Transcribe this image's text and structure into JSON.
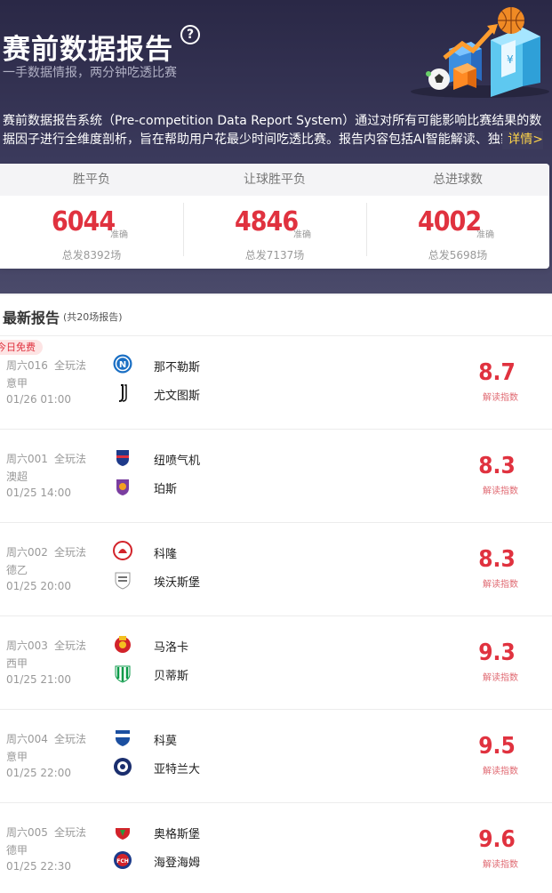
{
  "header": {
    "title": "赛前数据报告",
    "help_icon": "question-circle-icon",
    "subtitle": "一手数据情报，两分钟吃透比赛",
    "description": "赛前数据报告系统（Pre-competition Data Report System）通过对所有可能影响比赛结果的数据因子进行全维度剖析，旨在帮助用户花最少时间吃透比赛。报告内容包括AI智能解读、独家临场",
    "more_label": "详情>"
  },
  "stats": [
    {
      "title": "胜平负",
      "number": "6044",
      "accuracy_label": "准确",
      "total": "总发8392场"
    },
    {
      "title": "让球胜平负",
      "number": "4846",
      "accuracy_label": "准确",
      "total": "总发7137场"
    },
    {
      "title": "总进球数",
      "number": "4002",
      "accuracy_label": "准确",
      "total": "总发5698场"
    }
  ],
  "reports": {
    "title": "最新报告",
    "count": "(共20场报告)",
    "free_tag": "今日免费",
    "score_label": "解读指数",
    "items": [
      {
        "week": "周六016",
        "play": "全玩法",
        "league": "意甲",
        "time": "01/26 01:00",
        "home": "那不勒斯",
        "away": "尤文图斯",
        "home_logo": "napoli-logo-icon",
        "away_logo": "juventus-logo-icon",
        "score": "8.7"
      },
      {
        "week": "周六001",
        "play": "全玩法",
        "league": "澳超",
        "time": "01/25 14:00",
        "home": "纽喷气机",
        "away": "珀斯",
        "home_logo": "newcastle-jets-logo-icon",
        "away_logo": "perth-glory-logo-icon",
        "score": "8.3"
      },
      {
        "week": "周六002",
        "play": "全玩法",
        "league": "德乙",
        "time": "01/25 20:00",
        "home": "科隆",
        "away": "埃沃斯堡",
        "home_logo": "koln-logo-icon",
        "away_logo": "elversberg-logo-icon",
        "score": "8.3"
      },
      {
        "week": "周六003",
        "play": "全玩法",
        "league": "西甲",
        "time": "01/25 21:00",
        "home": "马洛卡",
        "away": "贝蒂斯",
        "home_logo": "mallorca-logo-icon",
        "away_logo": "betis-logo-icon",
        "score": "9.3"
      },
      {
        "week": "周六004",
        "play": "全玩法",
        "league": "意甲",
        "time": "01/25 22:00",
        "home": "科莫",
        "away": "亚特兰大",
        "home_logo": "como-logo-icon",
        "away_logo": "atalanta-logo-icon",
        "score": "9.5"
      },
      {
        "week": "周六005",
        "play": "全玩法",
        "league": "德甲",
        "time": "01/25 22:30",
        "home": "奥格斯堡",
        "away": "海登海姆",
        "home_logo": "augsburg-logo-icon",
        "away_logo": "heidenheim-logo-icon",
        "score": "9.6"
      }
    ]
  },
  "colors": {
    "accent": "#e0323f",
    "header_bg": "#2a2846",
    "link": "#ffd54a"
  }
}
